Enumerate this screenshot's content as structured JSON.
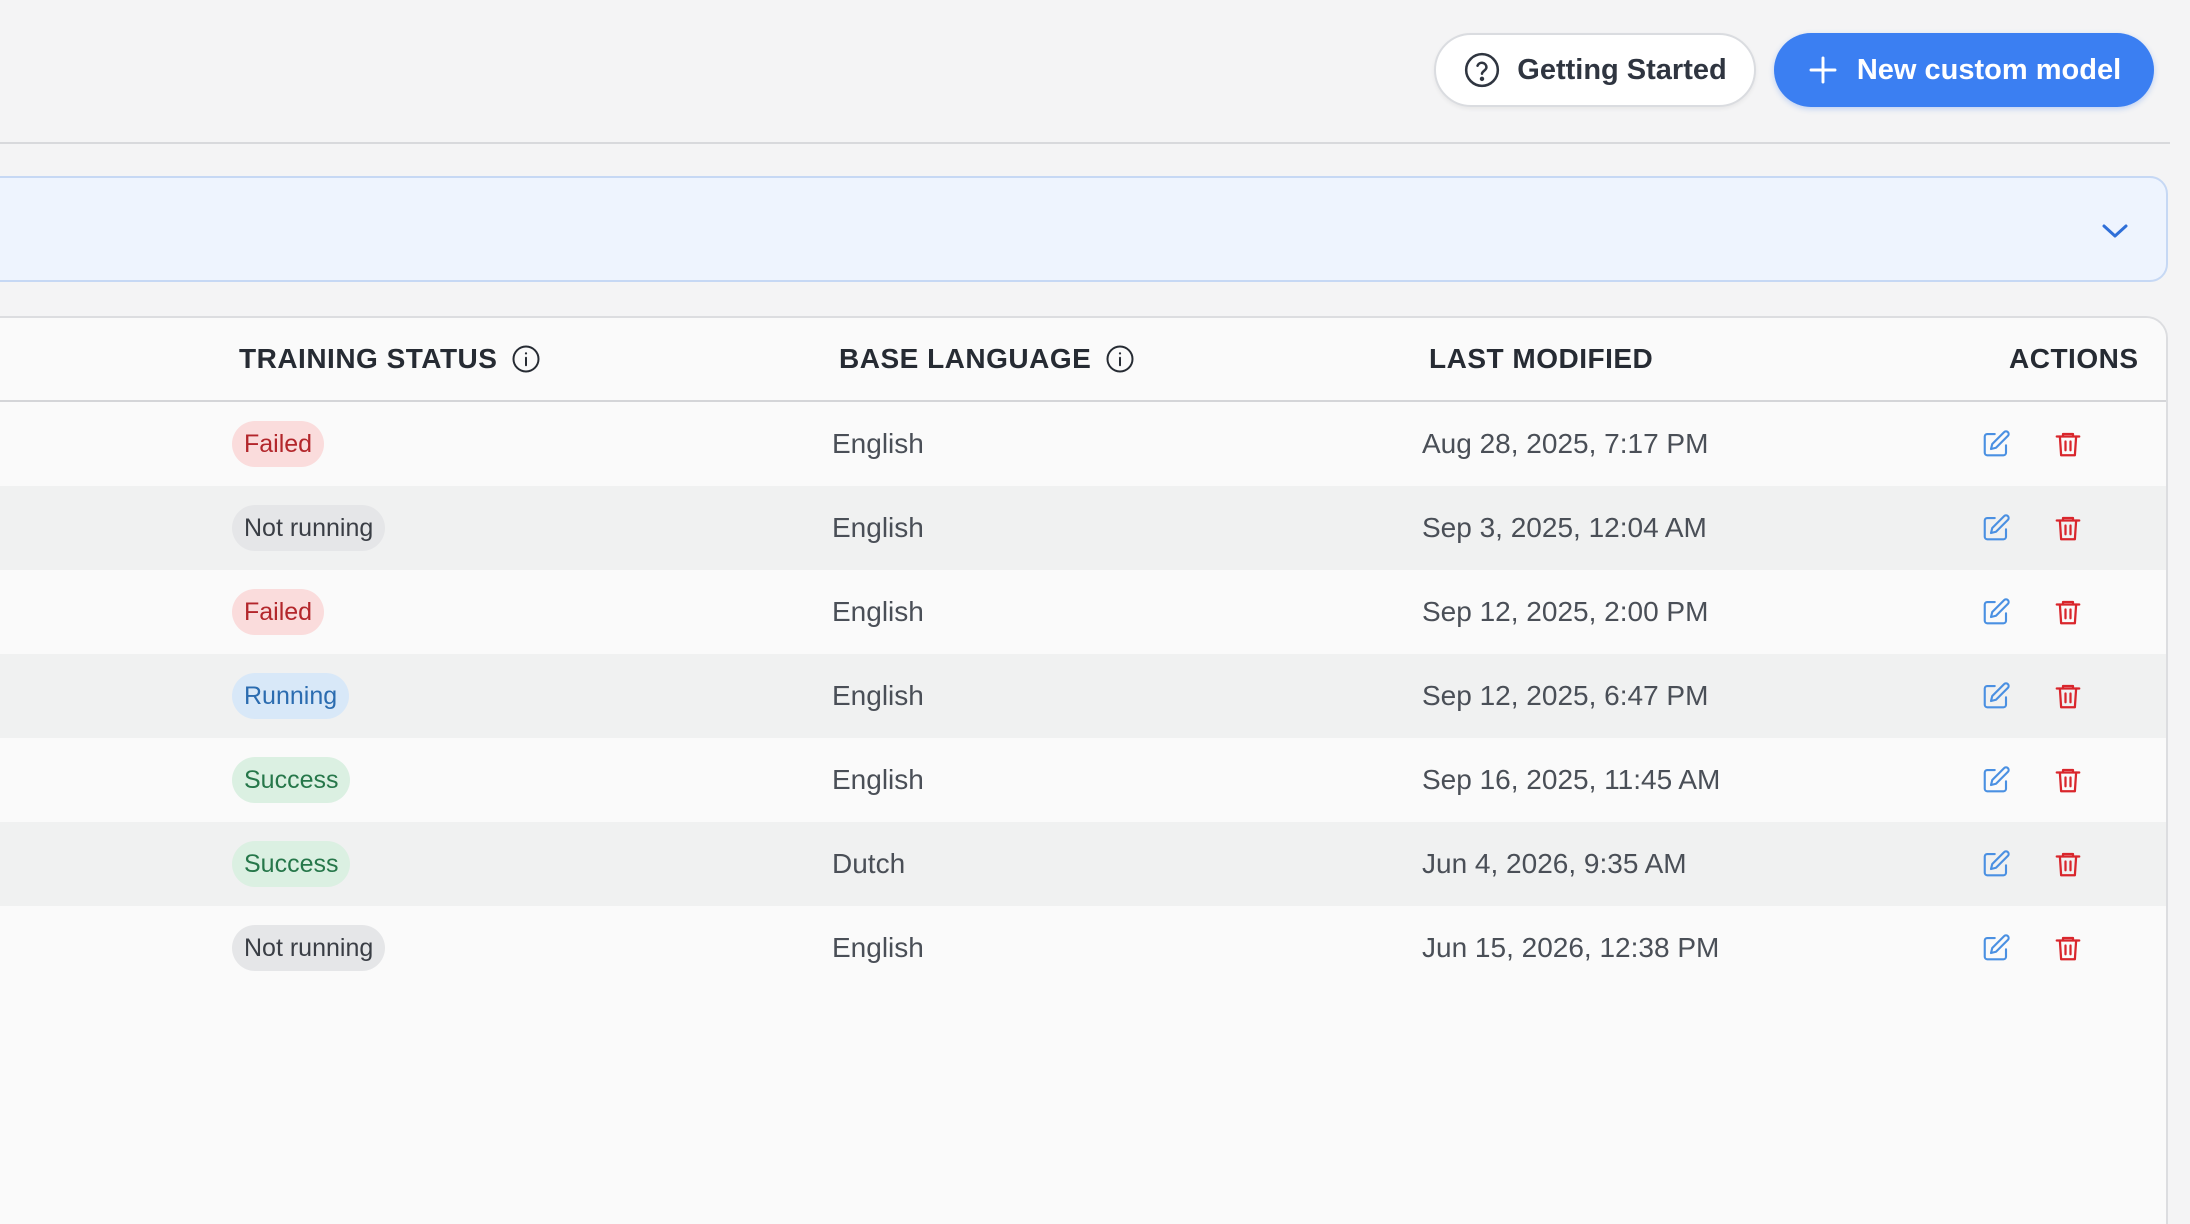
{
  "header": {
    "getting_started_label": "Getting Started",
    "new_model_label": "New custom model"
  },
  "table": {
    "columns": {
      "training_status": "TRAINING STATUS",
      "base_language": "BASE LANGUAGE",
      "last_modified": "LAST MODIFIED",
      "actions": "ACTIONS"
    },
    "rows": [
      {
        "status": "Failed",
        "status_kind": "failed",
        "language": "English",
        "modified": "Aug 28, 2025, 7:17 PM"
      },
      {
        "status": "Not running",
        "status_kind": "notrunning",
        "language": "English",
        "modified": "Sep 3, 2025, 12:04 AM"
      },
      {
        "status": "Failed",
        "status_kind": "failed",
        "language": "English",
        "modified": "Sep 12, 2025, 2:00 PM"
      },
      {
        "status": "Running",
        "status_kind": "running",
        "language": "English",
        "modified": "Sep 12, 2025, 6:47 PM"
      },
      {
        "status": "Success",
        "status_kind": "success",
        "language": "English",
        "modified": "Sep 16, 2025, 11:45 AM"
      },
      {
        "status": "Success",
        "status_kind": "success",
        "language": "Dutch",
        "modified": "Jun 4, 2026, 9:35 AM"
      },
      {
        "status": "Not running",
        "status_kind": "notrunning",
        "language": "English",
        "modified": "Jun 15, 2026, 12:38 PM"
      }
    ]
  },
  "icons": {
    "help": "question-circle-icon",
    "plus": "plus-icon",
    "chevron": "chevron-down-icon",
    "info": "info-circle-icon",
    "edit": "edit-icon",
    "delete": "trash-icon"
  },
  "colors": {
    "accent": "#3b7ff2",
    "edit_icon": "#4a90e2",
    "delete_icon": "#d9262c"
  }
}
